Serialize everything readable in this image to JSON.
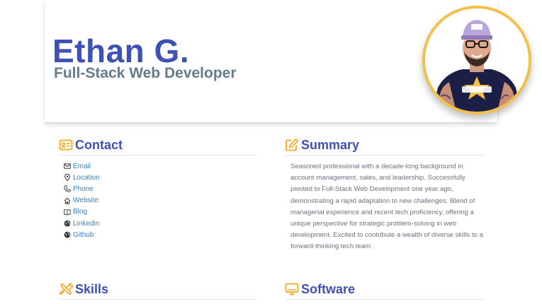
{
  "header": {
    "name": "Ethan G.",
    "role": "Full-Stack Web Developer",
    "avatar_icon": "profile-photo",
    "avatar_border_color": "#f5c04a"
  },
  "colors": {
    "accent": "#3f51b5",
    "icon_orange": "#f5a623",
    "link": "#3b82c4",
    "muted_text": "#6b7280",
    "role_gray": "#647c8b"
  },
  "contact": {
    "title": "Contact",
    "icon": "id-card-icon",
    "items": [
      {
        "label": "Email",
        "icon": "envelope-icon"
      },
      {
        "label": "Location",
        "icon": "map-pin-icon"
      },
      {
        "label": "Phone",
        "icon": "phone-icon"
      },
      {
        "label": "Website",
        "icon": "house-icon"
      },
      {
        "label": "Blog",
        "icon": "book-open-icon"
      },
      {
        "label": "Linkedin",
        "icon": "globe-icon"
      },
      {
        "label": "Github",
        "icon": "globe-icon"
      }
    ]
  },
  "summary": {
    "title": "Summary",
    "icon": "pencil-square-icon",
    "text": "Seasoned professional with a decade-long background in account management, sales, and leadership. Successfully pivoted to Full-Stack Web Development one year ago, demonstrating a rapid adaptation to new challenges. Blend of managerial experience and recent tech proficiency, offering a unique perspective for strategic problem-solving in web development. Excited to contribute a wealth of diverse skills to a forward-thinking tech team."
  },
  "skills": {
    "title": "Skills",
    "icon": "tools-icon"
  },
  "software": {
    "title": "Software",
    "icon": "monitor-icon"
  }
}
